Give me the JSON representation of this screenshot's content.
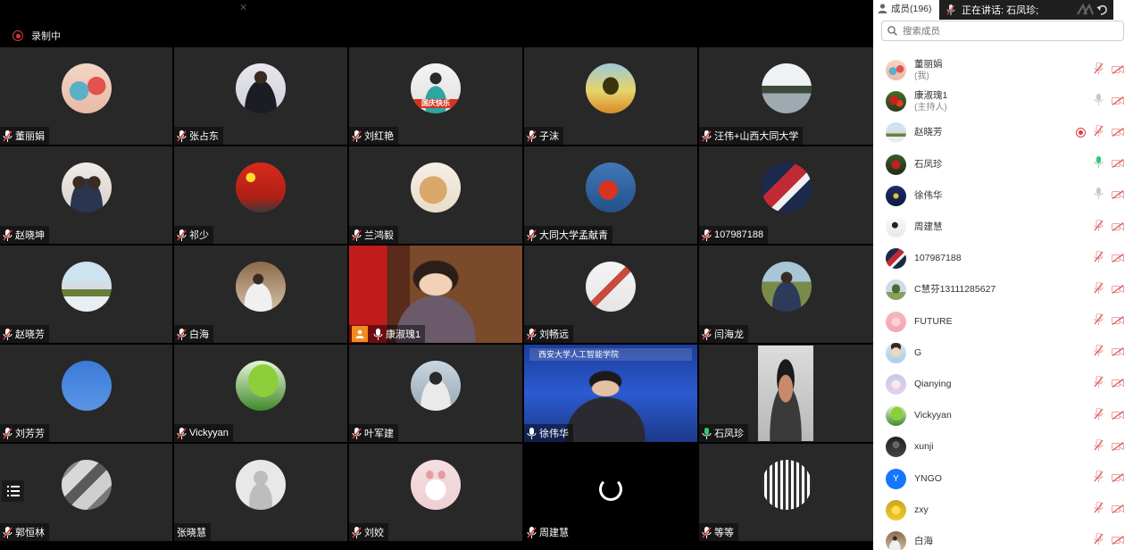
{
  "recording": {
    "label": "录制中"
  },
  "speaking": {
    "label": "正在讲话: 石凤珍;"
  },
  "panel": {
    "members_label": "成员(196)",
    "search_placeholder": "搜索成员",
    "members": [
      {
        "name": "董丽娟",
        "role": "(我)",
        "mic": "muted",
        "recording": false,
        "avatar": "flowers"
      },
      {
        "name": "康淑瑰1",
        "role": "(主持人)",
        "mic": "on",
        "recording": false,
        "avatar": "red-flowers"
      },
      {
        "name": "赵晓芳",
        "role": "",
        "mic": "muted",
        "recording": true,
        "avatar": "stadium"
      },
      {
        "name": "石凤珍",
        "role": "",
        "mic": "speaking",
        "recording": false,
        "avatar": "rose"
      },
      {
        "name": "徐伟华",
        "role": "",
        "mic": "on",
        "recording": false,
        "avatar": "blue-night"
      },
      {
        "name": "周建慧",
        "role": "",
        "mic": "muted",
        "recording": false,
        "avatar": "sketch"
      },
      {
        "name": "107987188",
        "role": "",
        "mic": "muted",
        "recording": false,
        "avatar": "flag"
      },
      {
        "name": "C慧芬13111285627",
        "role": "",
        "mic": "muted",
        "recording": false,
        "avatar": "tree"
      },
      {
        "name": "FUTURE",
        "role": "",
        "mic": "muted",
        "recording": false,
        "avatar": "pink"
      },
      {
        "name": "G",
        "role": "",
        "mic": "muted",
        "recording": false,
        "avatar": "cartoon"
      },
      {
        "name": "Qianying",
        "role": "",
        "mic": "muted",
        "recording": false,
        "avatar": "anime"
      },
      {
        "name": "Vickyyan",
        "role": "",
        "mic": "muted",
        "recording": false,
        "avatar": "leaf"
      },
      {
        "name": "xunji",
        "role": "",
        "mic": "muted",
        "recording": false,
        "avatar": "dark"
      },
      {
        "name": "YNGO",
        "role": "",
        "mic": "muted",
        "recording": false,
        "avatar": "letter",
        "letter": "Y"
      },
      {
        "name": "zxy",
        "role": "",
        "mic": "muted",
        "recording": false,
        "avatar": "yellow"
      },
      {
        "name": "白海",
        "role": "",
        "mic": "muted",
        "recording": false,
        "avatar": "person"
      }
    ]
  },
  "tiles": [
    {
      "name": "董丽娟",
      "mic": "muted",
      "kind": "avatar",
      "avatar": "flowers"
    },
    {
      "name": "张占东",
      "mic": "muted",
      "kind": "avatar",
      "avatar": "man-suit"
    },
    {
      "name": "刘红艳",
      "mic": "muted",
      "kind": "avatar",
      "avatar": "guoqing",
      "avatar_text": "国庆快乐"
    },
    {
      "name": "子沫",
      "mic": "muted",
      "kind": "avatar",
      "avatar": "sunset-tree"
    },
    {
      "name": "汪伟+山西大同大学",
      "mic": "muted",
      "kind": "avatar",
      "avatar": "lake"
    },
    {
      "name": "赵晓坤",
      "mic": "muted",
      "kind": "avatar",
      "avatar": "family"
    },
    {
      "name": "祁少",
      "mic": "muted",
      "kind": "avatar",
      "avatar": "china-flag"
    },
    {
      "name": "兰鸿毅",
      "mic": "muted",
      "kind": "avatar",
      "avatar": "cat"
    },
    {
      "name": "大同大学孟献青",
      "mic": "muted",
      "kind": "avatar",
      "avatar": "apple"
    },
    {
      "name": "107987188",
      "mic": "muted",
      "kind": "avatar",
      "avatar": "flag"
    },
    {
      "name": "赵晓芳",
      "mic": "muted",
      "kind": "avatar",
      "avatar": "stadium"
    },
    {
      "name": "白海",
      "mic": "muted",
      "kind": "avatar",
      "avatar": "person"
    },
    {
      "name": "康淑瑰1",
      "mic": "on",
      "kind": "video",
      "video": "host",
      "host": true
    },
    {
      "name": "刘畅远",
      "mic": "muted",
      "kind": "avatar",
      "avatar": "document"
    },
    {
      "name": "闫海龙",
      "mic": "muted",
      "kind": "avatar",
      "avatar": "man-outdoor"
    },
    {
      "name": "刘芳芳",
      "mic": "muted",
      "kind": "avatar",
      "avatar": "blue-sky"
    },
    {
      "name": "Vickyyan",
      "mic": "muted",
      "kind": "avatar",
      "avatar": "leaf"
    },
    {
      "name": "叶军建",
      "mic": "muted",
      "kind": "avatar",
      "avatar": "man-glasses"
    },
    {
      "name": "徐伟华",
      "mic": "on",
      "kind": "video",
      "video": "presenter",
      "banner": "西安大学人工智能学院"
    },
    {
      "name": "石凤珍",
      "mic": "speaking",
      "kind": "video",
      "video": "speaker",
      "active": true
    },
    {
      "name": "郭恒林",
      "mic": "muted",
      "kind": "avatar",
      "avatar": "aerial"
    },
    {
      "name": "张晓慧",
      "mic": "none",
      "kind": "avatar",
      "avatar": "default"
    },
    {
      "name": "刘姣",
      "mic": "muted",
      "kind": "avatar",
      "avatar": "bunny"
    },
    {
      "name": "周建慧",
      "mic": "muted",
      "kind": "loading"
    },
    {
      "name": "等等",
      "mic": "muted",
      "kind": "avatar",
      "avatar": "qrcode"
    }
  ],
  "colors": {
    "panel_bg": "#ffffff",
    "tile_bg": "#282828",
    "active_border": "#2ecc71",
    "record_red": "#e03a3a",
    "host_badge": "#f28c1e"
  }
}
